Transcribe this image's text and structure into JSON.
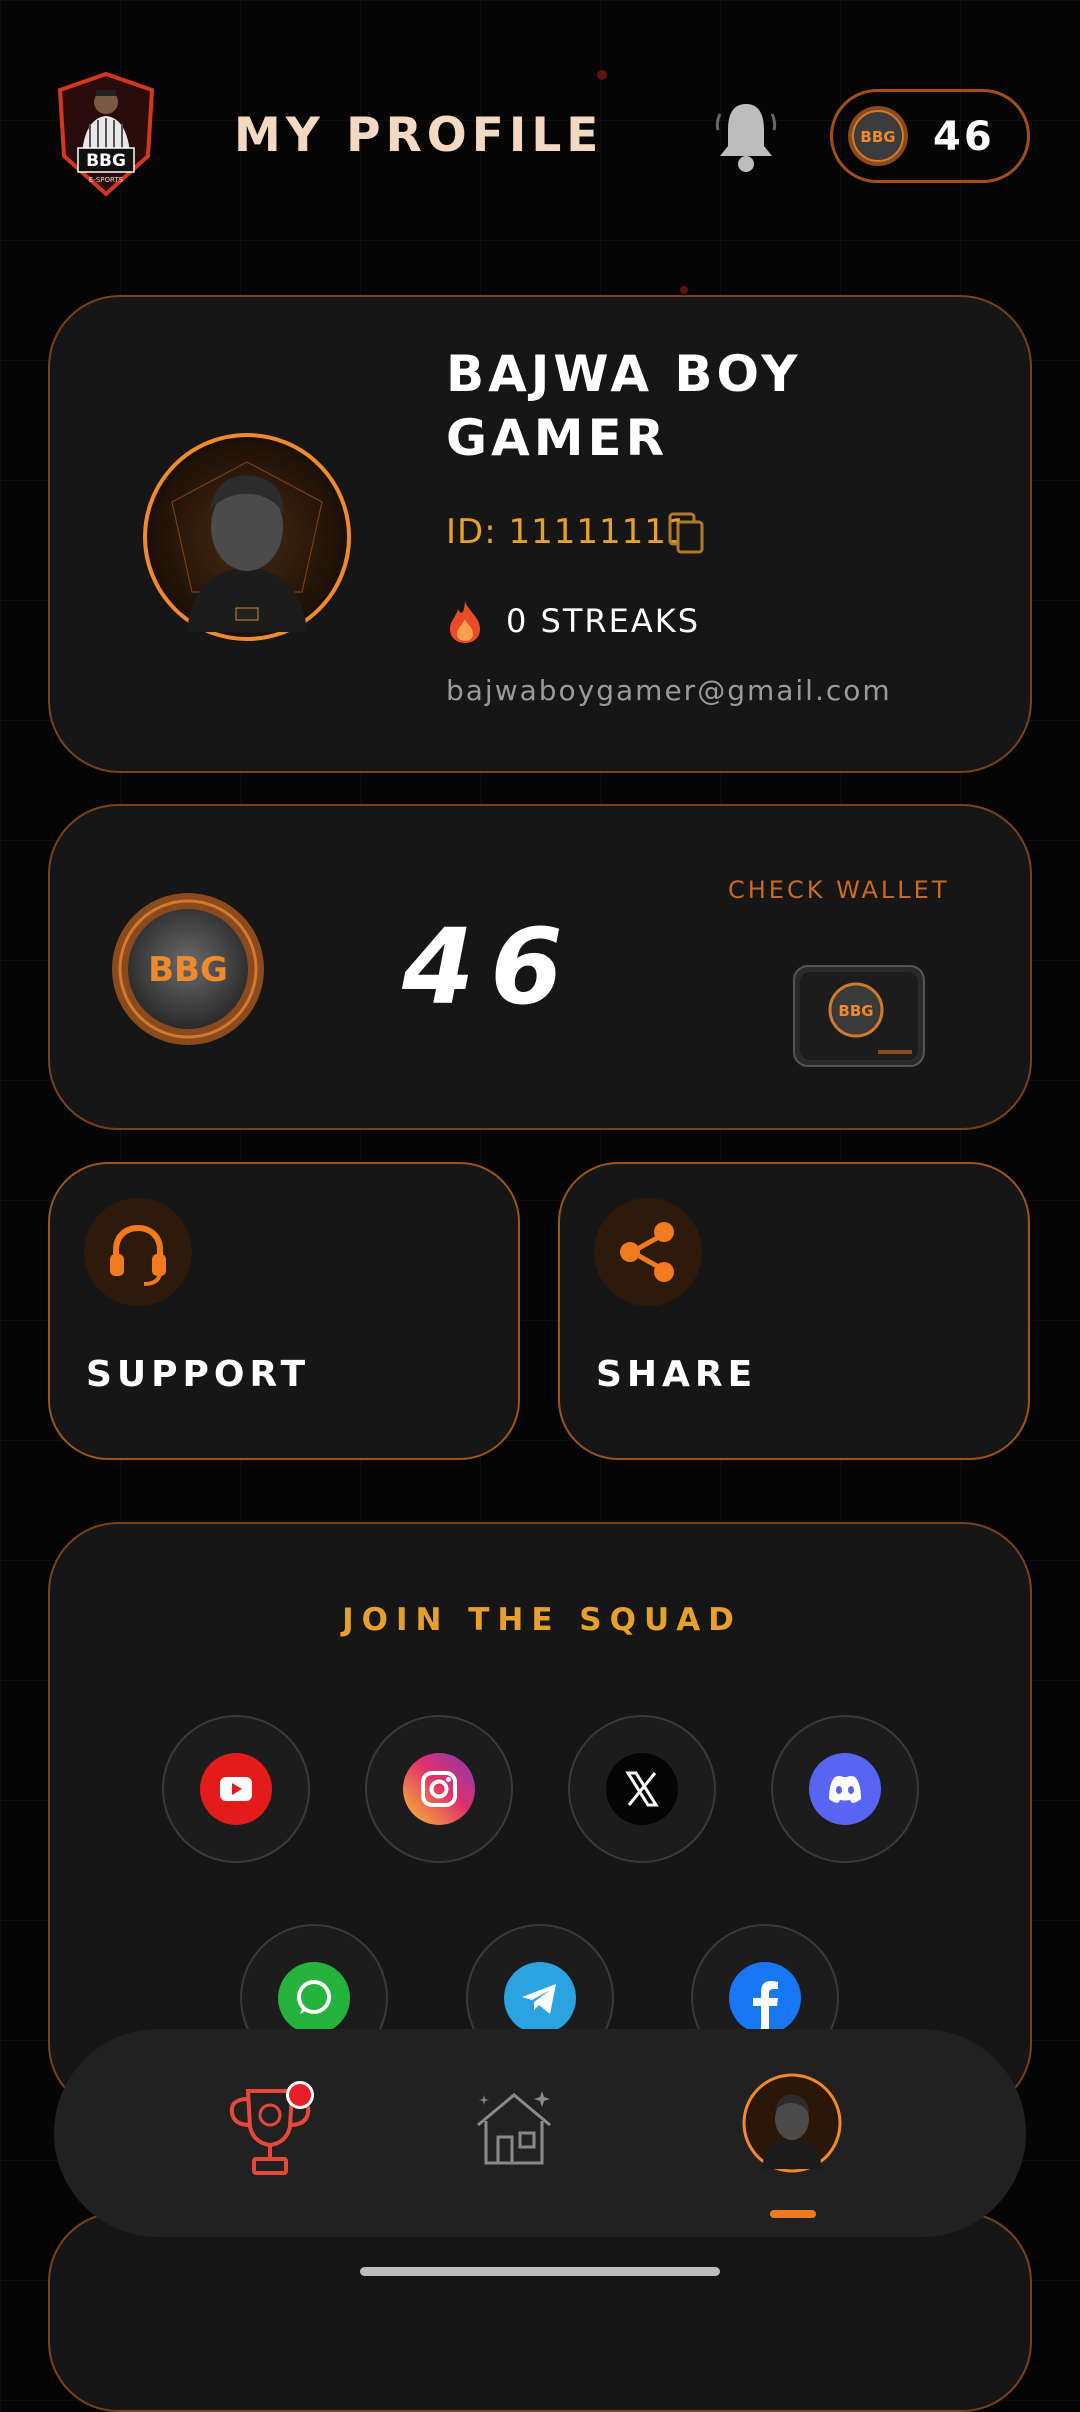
{
  "header": {
    "title": "MY PROFILE",
    "coin_balance": "46",
    "logo_text": "BBG",
    "logo_subtext": "E-SPORTS"
  },
  "profile": {
    "name_line1": "BAJWA BOY",
    "name_line2": "GAMER",
    "id_text": "ID: 11111111",
    "streaks_text": "0 STREAKS",
    "email": "bajwaboygamer@gmail.com"
  },
  "wallet": {
    "coin_text": "BBG",
    "balance": "46",
    "check_label": "CHECK WALLET"
  },
  "actions": {
    "support_label": "SUPPORT",
    "share_label": "SHARE"
  },
  "squad": {
    "title": "JOIN THE SQUAD",
    "socials": [
      "youtube-icon",
      "instagram-icon",
      "x-icon",
      "discord-icon",
      "whatsapp-icon",
      "telegram-icon",
      "facebook-icon"
    ]
  },
  "nav": {
    "items": [
      "trophy-icon",
      "home-icon",
      "profile-avatar"
    ],
    "active": "profile-avatar"
  },
  "colors": {
    "accent": "#f07a1d",
    "gold": "#e7a12b",
    "card_border": "#7a4216",
    "background": "#050505"
  }
}
